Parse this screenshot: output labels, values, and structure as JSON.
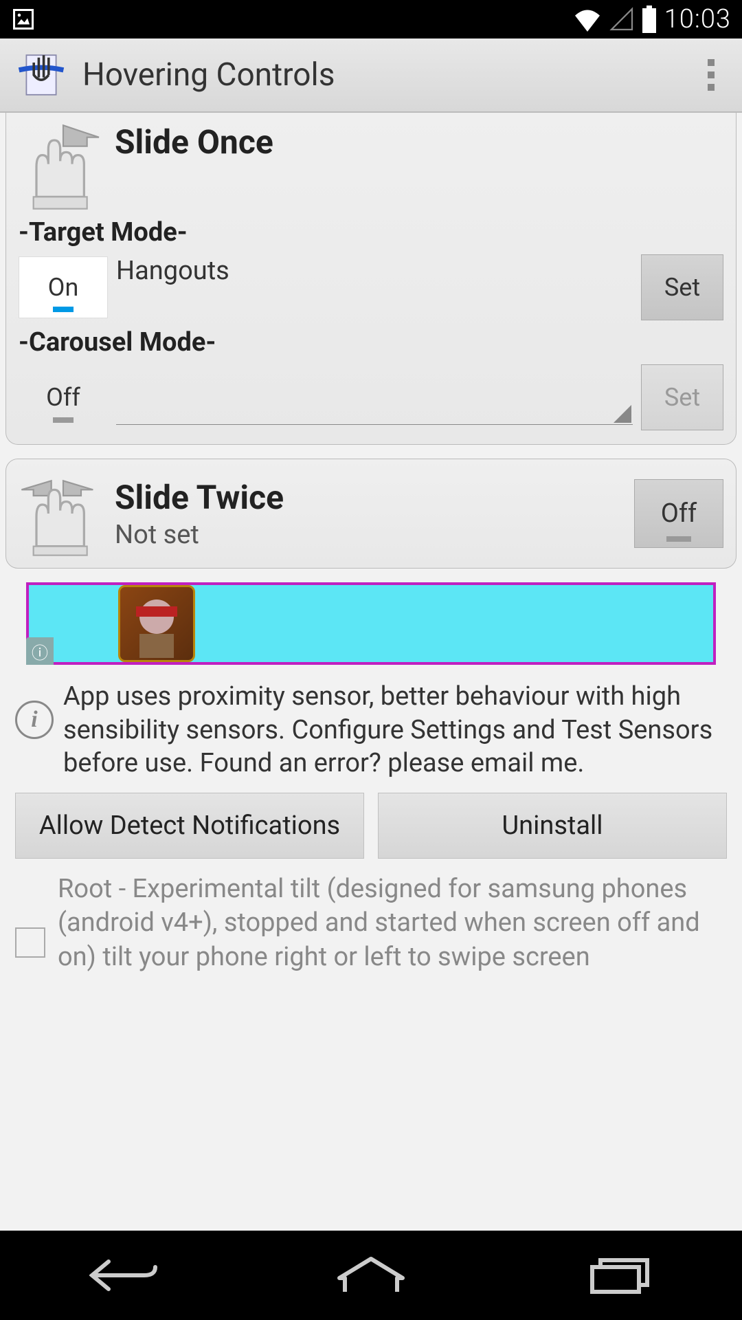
{
  "statusbar": {
    "time": "10:03"
  },
  "actionbar": {
    "title": "Hovering Controls"
  },
  "slide_once": {
    "title": "Slide Once",
    "target_mode_label": "-Target Mode-",
    "target_toggle": "On",
    "target_value": "Hangouts",
    "target_set_btn": "Set",
    "carousel_mode_label": "-Carousel Mode-",
    "carousel_toggle": "Off",
    "carousel_set_btn": "Set"
  },
  "slide_twice": {
    "title": "Slide Twice",
    "subtitle": "Not set",
    "toggle": "Off"
  },
  "info": {
    "text": "App uses proximity sensor, better behaviour with high sensibility sensors. Configure Settings and Test Sensors before use. Found an error? please email me."
  },
  "buttons": {
    "allow_notifications": "Allow Detect Notifications",
    "uninstall": "Uninstall"
  },
  "root_tilt": {
    "text": "Root - Experimental tilt (designed for samsung phones (android v4+), stopped and started when screen off and on) tilt your phone right or left to swipe screen"
  }
}
